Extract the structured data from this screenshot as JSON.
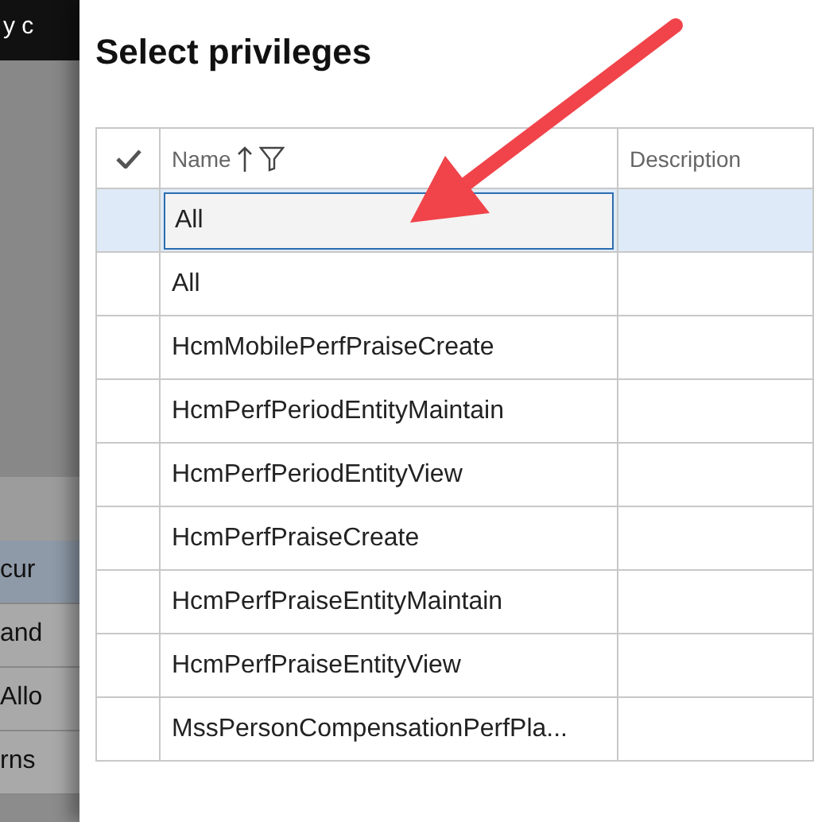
{
  "background": {
    "header_text": "y c",
    "rows": [
      {
        "text": "cur",
        "selected": true
      },
      {
        "text": "and",
        "selected": false
      },
      {
        "text": "Allo",
        "selected": false
      },
      {
        "text": "rns",
        "selected": false
      }
    ]
  },
  "dialog": {
    "title": "Select privileges",
    "table": {
      "columns": [
        {
          "label": "Name",
          "sorted": true,
          "filter": true
        },
        {
          "label": "Description",
          "sorted": false,
          "filter": false
        }
      ],
      "rows": [
        {
          "name": "All",
          "selected": true,
          "editing": true
        },
        {
          "name": "All",
          "selected": false,
          "editing": false
        },
        {
          "name": "HcmMobilePerfPraiseCreate",
          "selected": false,
          "editing": false
        },
        {
          "name": "HcmPerfPeriodEntityMaintain",
          "selected": false,
          "editing": false
        },
        {
          "name": "HcmPerfPeriodEntityView",
          "selected": false,
          "editing": false
        },
        {
          "name": "HcmPerfPraiseCreate",
          "selected": false,
          "editing": false
        },
        {
          "name": "HcmPerfPraiseEntityMaintain",
          "selected": false,
          "editing": false
        },
        {
          "name": "HcmPerfPraiseEntityView",
          "selected": false,
          "editing": false
        },
        {
          "name": "MssPersonCompensationPerfPla...",
          "selected": false,
          "editing": false
        }
      ]
    }
  },
  "annotation": {
    "kind": "arrow"
  }
}
